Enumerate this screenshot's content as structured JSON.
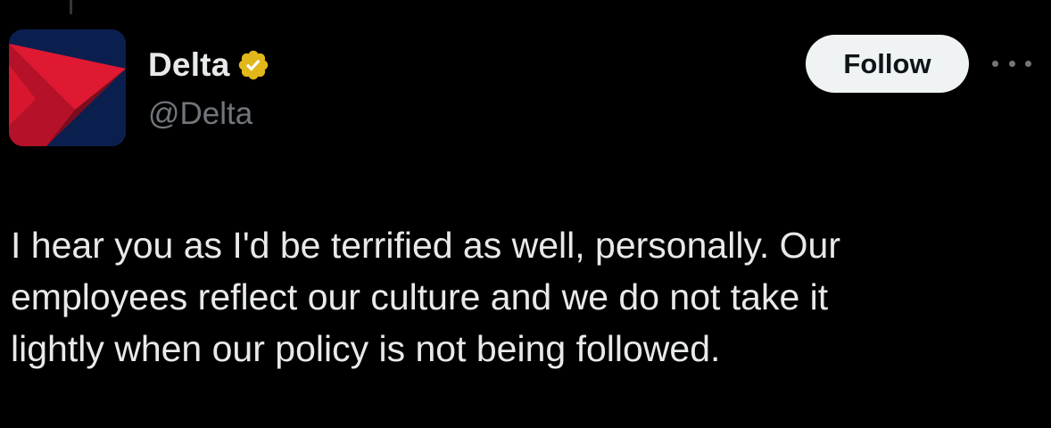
{
  "account": {
    "display_name": "Delta",
    "handle": "@Delta",
    "verified": true,
    "avatar_icon": "delta-widget-logo",
    "verified_icon": "gold-verified-badge"
  },
  "actions": {
    "follow_label": "Follow",
    "more_icon": "more-horizontal-icon"
  },
  "tweet": {
    "text": "I hear you as I'd be terrified as well, personally. Our\nemployees reflect our culture and we do not take it\nlightly when our policy is not being followed."
  },
  "colors": {
    "background": "#000000",
    "text_primary": "#e7e9ea",
    "text_secondary": "#71767b",
    "follow_button_bg": "#eff3f4",
    "verified_gold": "#e2b719",
    "brand_red": "#e01933",
    "brand_navy": "#0b1f4f"
  }
}
